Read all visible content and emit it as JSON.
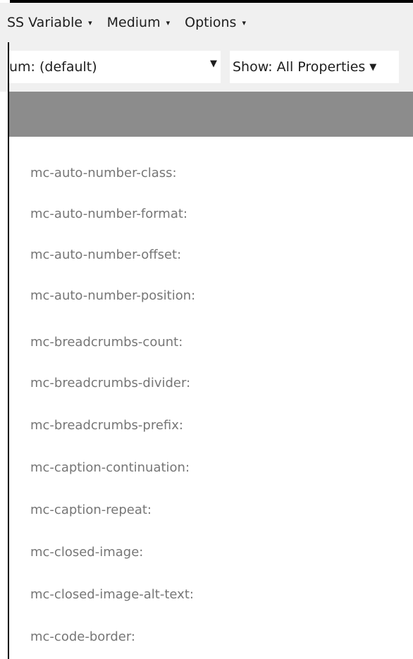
{
  "menu": {
    "css_variable": "SS Variable",
    "medium": "Medium",
    "options": "Options",
    "caret": "▾"
  },
  "toolbar": {
    "medium_select_value": "um: (default)",
    "show_select_value": "Show: All Properties",
    "dropdown_arrow": "▼"
  },
  "properties": [
    "mc-auto-number-class:",
    "mc-auto-number-format:",
    "mc-auto-number-offset:",
    "mc-auto-number-position:",
    "mc-breadcrumbs-count:",
    "mc-breadcrumbs-divider:",
    "mc-breadcrumbs-prefix:",
    "mc-caption-continuation:",
    "mc-caption-repeat:",
    "mc-closed-image:",
    "mc-closed-image-alt-text:",
    "mc-code-border:"
  ],
  "colors": {
    "header_grey": "#8c8c8c",
    "toolbar_bg": "#f0f0f0",
    "property_text": "#767676"
  }
}
